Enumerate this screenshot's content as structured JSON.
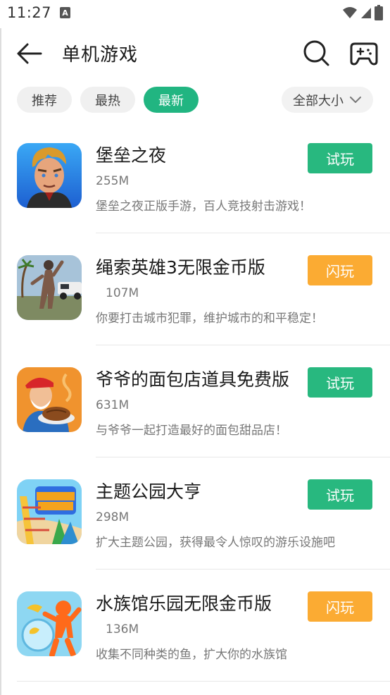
{
  "status_bar": {
    "time": "11:27",
    "notification_badge": "A"
  },
  "header": {
    "title": "单机游戏"
  },
  "filters": {
    "tabs": [
      {
        "label": "推荐",
        "active": false
      },
      {
        "label": "最热",
        "active": false
      },
      {
        "label": "最新",
        "active": true
      }
    ],
    "size_select": "全部大小"
  },
  "colors": {
    "accent_green": "#28b87f",
    "accent_orange": "#fbab33",
    "chip_active": "#21b581"
  },
  "apps": [
    {
      "name": "堡垒之夜",
      "size": "255M",
      "desc": "堡垒之夜正版手游，百人竞技射击游戏！",
      "action": "试玩",
      "icon": "fortnite-icon"
    },
    {
      "name": "绳索英雄3无限金币版",
      "size": "107M",
      "desc": "你要打击城市犯罪，维护城市的和平稳定！",
      "action": "闪玩",
      "icon": "rope-hero-icon"
    },
    {
      "name": "爷爷的面包店道具免费版",
      "size": "631M",
      "desc": "与爷爷一起打造最好的面包甜品店！",
      "action": "试玩",
      "icon": "grandpa-bakery-icon"
    },
    {
      "name": "主题公园大亨",
      "size": "298M",
      "desc": "扩大主题公园，获得最令人惊叹的游乐设施吧",
      "action": "试玩",
      "icon": "theme-park-icon"
    },
    {
      "name": "水族馆乐园无限金币版",
      "size": "136M",
      "desc": "收集不同种类的鱼，扩大你的水族馆",
      "action": "闪玩",
      "icon": "aquarium-icon"
    }
  ],
  "icons": {
    "back": "arrow-left-icon",
    "search": "search-icon",
    "gamepad": "gamepad-icon",
    "dropdown": "chevron-down-icon",
    "wifi": "wifi-icon",
    "signal": "signal-icon",
    "battery": "battery-icon"
  }
}
